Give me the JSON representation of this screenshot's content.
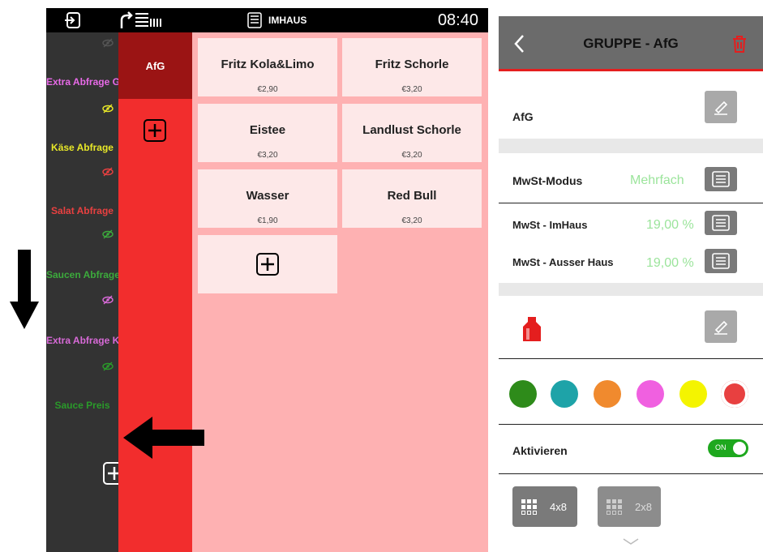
{
  "topbar": {
    "mode": "IMHAUS",
    "time": "08:40"
  },
  "modifiers": [
    {
      "label": "",
      "color": "#888888",
      "eye_color": "#555555"
    },
    {
      "label": "Extra Abfrage Gr",
      "color": "#e86ae8"
    },
    {
      "label": "Käse Abfrage",
      "color": "#e8e828"
    },
    {
      "label": "Salat Abfrage",
      "color": "#e84040"
    },
    {
      "label": "Saucen Abfrage",
      "color": "#3caa3c"
    },
    {
      "label": "Extra Abfrage Kl",
      "color": "#d86ad8"
    },
    {
      "label": "Sauce Preis",
      "color": "#2a9a2a"
    }
  ],
  "groups": [
    {
      "label": "AfG"
    }
  ],
  "products": [
    {
      "name": "Fritz Kola&Limo",
      "price": "€2,90"
    },
    {
      "name": "Fritz Schorle",
      "price": "€3,20"
    },
    {
      "name": "Eistee",
      "price": "€3,20"
    },
    {
      "name": "Landlust Schorle",
      "price": "€3,20"
    },
    {
      "name": "Wasser",
      "price": "€1,90"
    },
    {
      "name": "Red Bull",
      "price": "€3,20"
    }
  ],
  "panel": {
    "title": "GRUPPE - AfG",
    "group_name": "AfG",
    "mwst_mode_label": "MwSt-Modus",
    "mwst_mode_value": "Mehrfach",
    "mwst_imhaus_label": "MwSt - ImHaus",
    "mwst_imhaus_value": "19,00 %",
    "mwst_ausser_label": "MwSt - Ausser Haus",
    "mwst_ausser_value": "19,00 %",
    "colors": [
      "#2e8b1a",
      "#1ea3a8",
      "#f08a2e",
      "#f060e0",
      "#f4f400",
      "#e84040"
    ],
    "activate_label": "Aktivieren",
    "toggle_label": "ON",
    "layout_options": [
      "4x8",
      "2x8"
    ]
  }
}
